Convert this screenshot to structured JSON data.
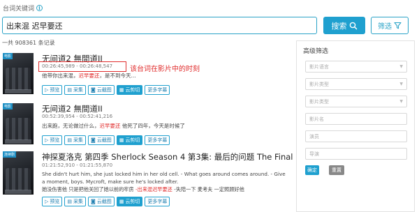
{
  "search": {
    "label": "台词关键词",
    "query": "出来混 迟早要还",
    "search_label": "搜索",
    "filter_label": "筛选"
  },
  "count_text": "一共 908361 条记录",
  "annotation": "该台词在影片中的时刻",
  "buttons": {
    "preview": "预览",
    "capture": "采集",
    "screenshot": "云截图",
    "clip": "云剪切",
    "more": "更多字幕"
  },
  "results": [
    {
      "tag": "电影",
      "title": "无间道2 無間道II",
      "time": "00:26:45,989 - 00:26:48,547",
      "lines": [
        [
          {
            "t": "他带你出来混，"
          },
          {
            "t": "迟早要还",
            "hl": true
          },
          {
            "t": "，是不到今天..."
          }
        ]
      ]
    },
    {
      "tag": "电影",
      "title": "无间道2 無間道II",
      "time": "00:52:39,954 - 00:52:41,216",
      "lines": [
        [
          {
            "t": "出来跑，无论做过什么，"
          },
          {
            "t": "迟早要还",
            "hl": true
          },
          {
            "t": " 他死了四年，今天是时候了"
          }
        ]
      ]
    },
    {
      "tag": "连续剧",
      "title": "神探夏洛克 第四季 Sherlock Season 4 第3集: 最后的问题 The Final Problem",
      "time": "01:21:52,910 - 01:21:55,870",
      "lines": [
        [
          {
            "t": "She didn't hurt him, she just locked him in her old cell. - What goes around comes around. - Give"
          }
        ],
        [
          {
            "t": "a moment, boys. Mycroft, make sure he's locked after."
          }
        ],
        [
          {
            "t": "她没伤害他 只是把他关回了她以前的牢房 "
          },
          {
            "t": "-出来混迟早要还",
            "hl": true
          },
          {
            "t": " -失陪一下 麦考夫 一定照顾好他"
          }
        ]
      ]
    }
  ],
  "filter_panel": {
    "title": "高级筛选",
    "fields": [
      "影片语言",
      "影片类型",
      "影片类型",
      "影片名",
      "演员",
      "导演"
    ],
    "confirm_label": "确定",
    "reset_label": "重置"
  },
  "colors": {
    "accent": "#1fa0cf",
    "highlight": "#e02c2c"
  }
}
